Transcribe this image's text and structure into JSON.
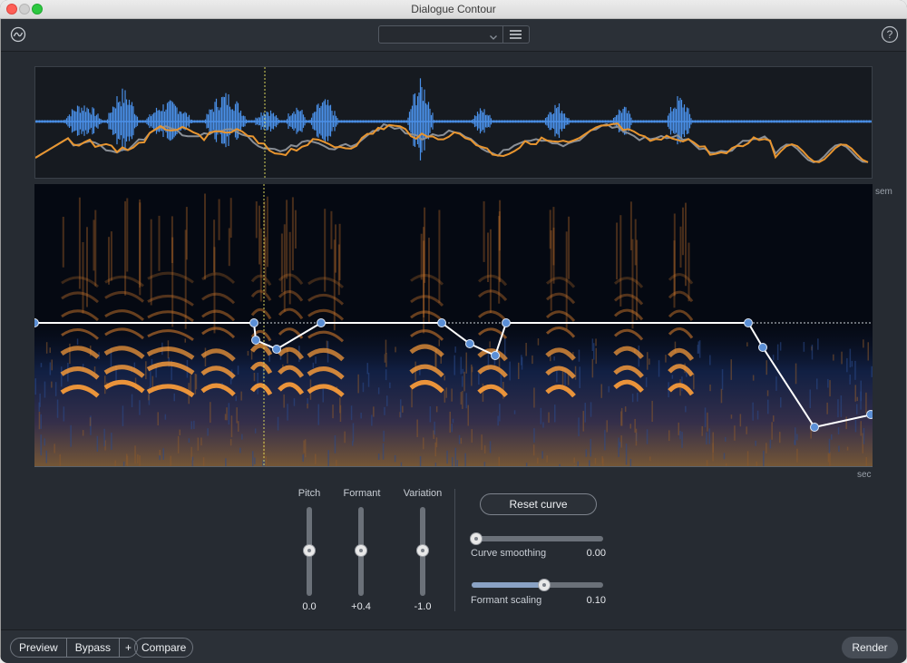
{
  "window": {
    "title": "Dialogue Contour"
  },
  "toolbar": {
    "preset_value": ""
  },
  "display": {
    "axis_semitones_label": "sem",
    "axis_seconds_label": "sec"
  },
  "sliders": {
    "pitch": {
      "label": "Pitch",
      "value": "0.0",
      "level": 0.5
    },
    "formant": {
      "label": "Formant",
      "value": "+0.4",
      "level": 0.5
    },
    "variation": {
      "label": "Variation",
      "value": "-1.0",
      "level": 0.5
    }
  },
  "curve": {
    "reset_label": "Reset curve",
    "smoothing": {
      "label": "Curve smoothing",
      "value": "0.00",
      "level": 0.0
    },
    "formant_scaling": {
      "label": "Formant scaling",
      "value": "0.10",
      "level": 0.55
    }
  },
  "bottom": {
    "preview": "Preview",
    "bypass": "Bypass",
    "plus": "+",
    "compare": "Compare",
    "render": "Render"
  },
  "colors": {
    "waveform": "#4a90e8",
    "pitch_contour": "#e8952f",
    "original_contour": "#8a8f96",
    "spectrogram_hot": "#f59a3a",
    "curve_line": "#ffffff",
    "curve_nodes": "#5b8fd6"
  },
  "icons": {
    "logo": "izotope-logo-icon",
    "dropdown": "chevron-down-icon",
    "menu": "hamburger-menu-icon",
    "help": "help-icon"
  }
}
